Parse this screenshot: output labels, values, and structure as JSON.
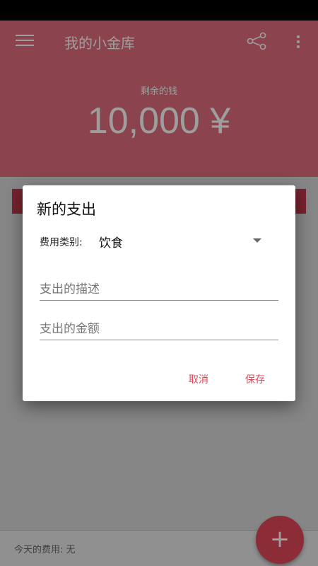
{
  "toolbar": {
    "title": "我的小金库"
  },
  "balance": {
    "label": "剩余的钱",
    "amount": "10,000 ¥"
  },
  "footer": {
    "today_expense": "今天的费用: 无"
  },
  "fab": {
    "label": "+"
  },
  "dialog": {
    "title": "新的支出",
    "category_label": "费用类别:",
    "category_value": "饮食",
    "description_placeholder": "支出的描述",
    "amount_placeholder": "支出的金额",
    "cancel_label": "取消",
    "save_label": "保存"
  },
  "colors": {
    "accent": "#e0485a",
    "header": "#e06d7d"
  }
}
